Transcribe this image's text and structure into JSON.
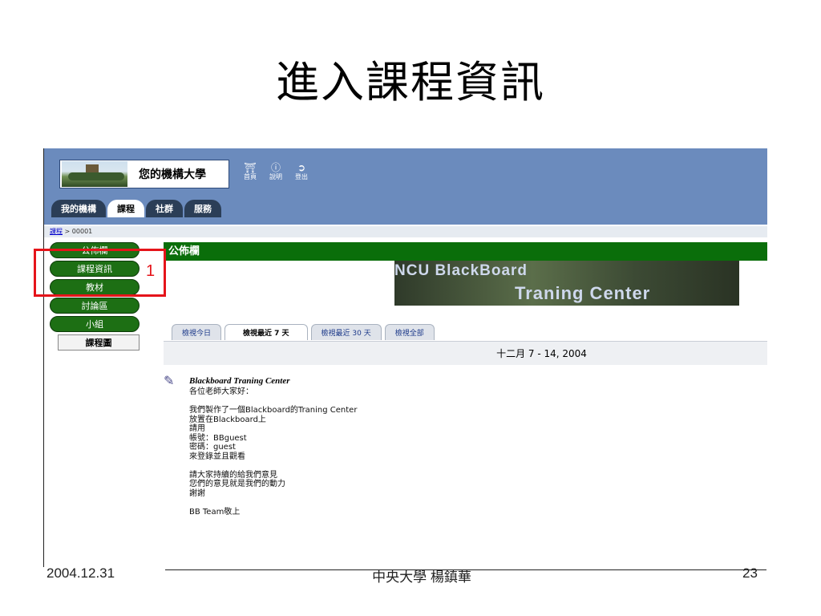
{
  "slide": {
    "title": "進入課程資訊",
    "footer_date": "2004.12.31",
    "footer_author": "中央大學  楊鎮華",
    "page_number": "23"
  },
  "portal": {
    "institution": "您的機構大學",
    "top_icons": [
      {
        "icon": "home-icon",
        "label": "首頁"
      },
      {
        "icon": "help-icon",
        "label": "說明"
      },
      {
        "icon": "logout-icon",
        "label": "登出"
      }
    ],
    "tabs": [
      "我的機構",
      "課程",
      "社群",
      "服務"
    ],
    "active_tab": "課程",
    "breadcrumb": {
      "link": "課程",
      "sep": " > ",
      "current": "00001"
    }
  },
  "course_menu": {
    "items": [
      "公佈欄",
      "課程資訊",
      "教材",
      "討論區",
      "小組"
    ],
    "map_button": "課程圖"
  },
  "annotation": {
    "marker": "1",
    "color": "#e5141a"
  },
  "announcements": {
    "header": "公佈欄",
    "banner_line1": "NCU BlackBoard",
    "banner_line2": "Traning Center",
    "view_tabs": [
      "檢視今日",
      "檢視最近 7 天",
      "檢視最近 30 天",
      "檢視全部"
    ],
    "active_view": "檢視最近 7 天",
    "date_range": "十二月 7 - 14, 2004",
    "post": {
      "title": "Blackboard Traning Center",
      "body": "各位老師大家好：\n\n我們製作了一個Blackboard的Traning Center\n放置在Blackboard上\n請用\n帳號：BBguest\n密碼：guest\n來登錄並且觀看\n\n請大家持續的給我們意見\n您們的意見就是我們的動力\n謝謝\n\nBB Team敬上"
    }
  },
  "colors": {
    "header_blue": "#6b8bbd",
    "menu_green": "#1d6f14",
    "announce_green": "#0a6e0a"
  }
}
